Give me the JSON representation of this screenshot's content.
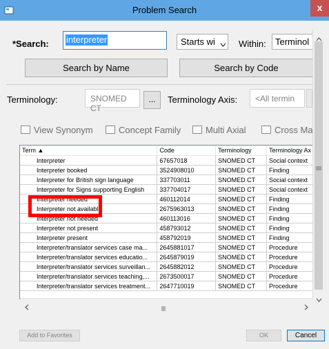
{
  "window": {
    "title": "Problem Search",
    "close_label": "x"
  },
  "search": {
    "label": "*Search:",
    "value": "interpreter",
    "match_mode": "Starts wi",
    "within_label": "Within:",
    "within_value": "Terminol",
    "by_name_button": "Search by Name",
    "by_code_button": "Search by Code"
  },
  "terminology": {
    "label": "Terminology:",
    "value": "SNOMED CT",
    "browse_label": "...",
    "axis_label": "Terminology Axis:",
    "axis_value": "<All termin"
  },
  "toolbar": {
    "view_synonym": "View Synonym",
    "concept_family": "Concept Family",
    "multi_axial": "Multi Axial",
    "cross_map": "Cross Ma"
  },
  "grid": {
    "columns": [
      "Term",
      "Code",
      "Terminology",
      "Terminology Ax"
    ],
    "rows": [
      [
        "Interpreter",
        "67657018",
        "SNOMED CT",
        "Social context"
      ],
      [
        "Interpreter booked",
        "3524908010",
        "SNOMED CT",
        "Finding"
      ],
      [
        "Interpreter for British sign language",
        "337703011",
        "SNOMED CT",
        "Social context"
      ],
      [
        "Interpreter for Signs supporting English",
        "337704017",
        "SNOMED CT",
        "Social context"
      ],
      [
        "Interpreter needed",
        "460112014",
        "SNOMED CT",
        "Finding"
      ],
      [
        "Interpreter not available",
        "2675963013",
        "SNOMED CT",
        "Finding"
      ],
      [
        "Interpreter not needed",
        "460113016",
        "SNOMED CT",
        "Finding"
      ],
      [
        "Interpreter not present",
        "458793012",
        "SNOMED CT",
        "Finding"
      ],
      [
        "Interpreter present",
        "458792019",
        "SNOMED CT",
        "Finding"
      ],
      [
        "Interpreter/translator services case ma...",
        "2645881017",
        "SNOMED CT",
        "Procedure"
      ],
      [
        "Interpreter/translator services educatio...",
        "2645879019",
        "SNOMED CT",
        "Procedure"
      ],
      [
        "Interpreter/translator services surveillan...",
        "2645882012",
        "SNOMED CT",
        "Procedure"
      ],
      [
        "Interpreter/translator services teaching,...",
        "2673500017",
        "SNOMED CT",
        "Procedure"
      ],
      [
        "Interpreter/translator services treatment...",
        "2647710019",
        "SNOMED CT",
        "Procedure"
      ]
    ]
  },
  "footer": {
    "add_favorites": "Add to Favorites",
    "ok": "OK",
    "cancel": "Cancel"
  },
  "colors": {
    "titlebar": "#5fa7e4",
    "highlight": "#ff0000",
    "close": "#c75050"
  }
}
